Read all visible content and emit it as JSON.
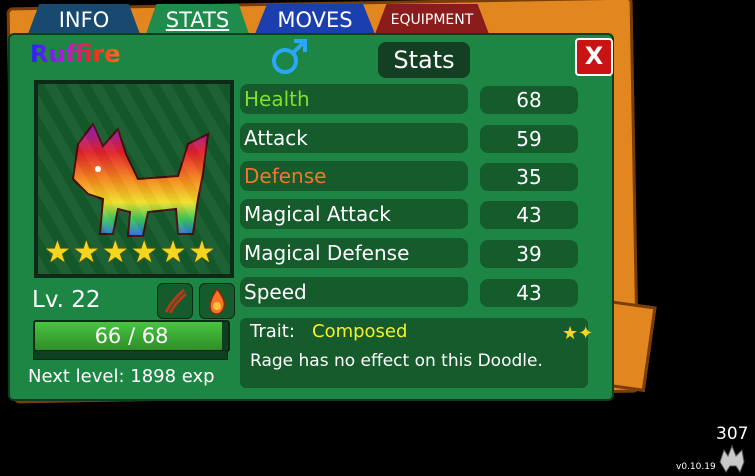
{
  "tabs": [
    {
      "label": "INFO"
    },
    {
      "label": "STATS"
    },
    {
      "label": "MOVES"
    },
    {
      "label": "EQUIPMENT"
    }
  ],
  "creature": {
    "name": "Ruffire",
    "gender_icon": "male-icon",
    "stars": 6,
    "level_text": "Lv. 22",
    "hp_text": "66 / 68",
    "hp_fraction": 0.97,
    "next_level_text": "Next level: 1898 exp"
  },
  "header": {
    "title": "Stats",
    "close_label": "X"
  },
  "stats": [
    {
      "label": "Health",
      "value": "68",
      "color": "#7ee02a"
    },
    {
      "label": "Attack",
      "value": "59",
      "color": "#ffffff"
    },
    {
      "label": "Defense",
      "value": "35",
      "color": "#f0782a"
    },
    {
      "label": "Magical Attack",
      "value": "43",
      "color": "#ffffff"
    },
    {
      "label": "Magical Defense",
      "value": "39",
      "color": "#ffffff"
    },
    {
      "label": "Speed",
      "value": "43",
      "color": "#ffffff"
    }
  ],
  "trait": {
    "label": "Trait:",
    "name": "Composed",
    "description": "Rage has no effect on this Doodle."
  },
  "corner": {
    "count": "307",
    "version": "v0.10.19"
  }
}
